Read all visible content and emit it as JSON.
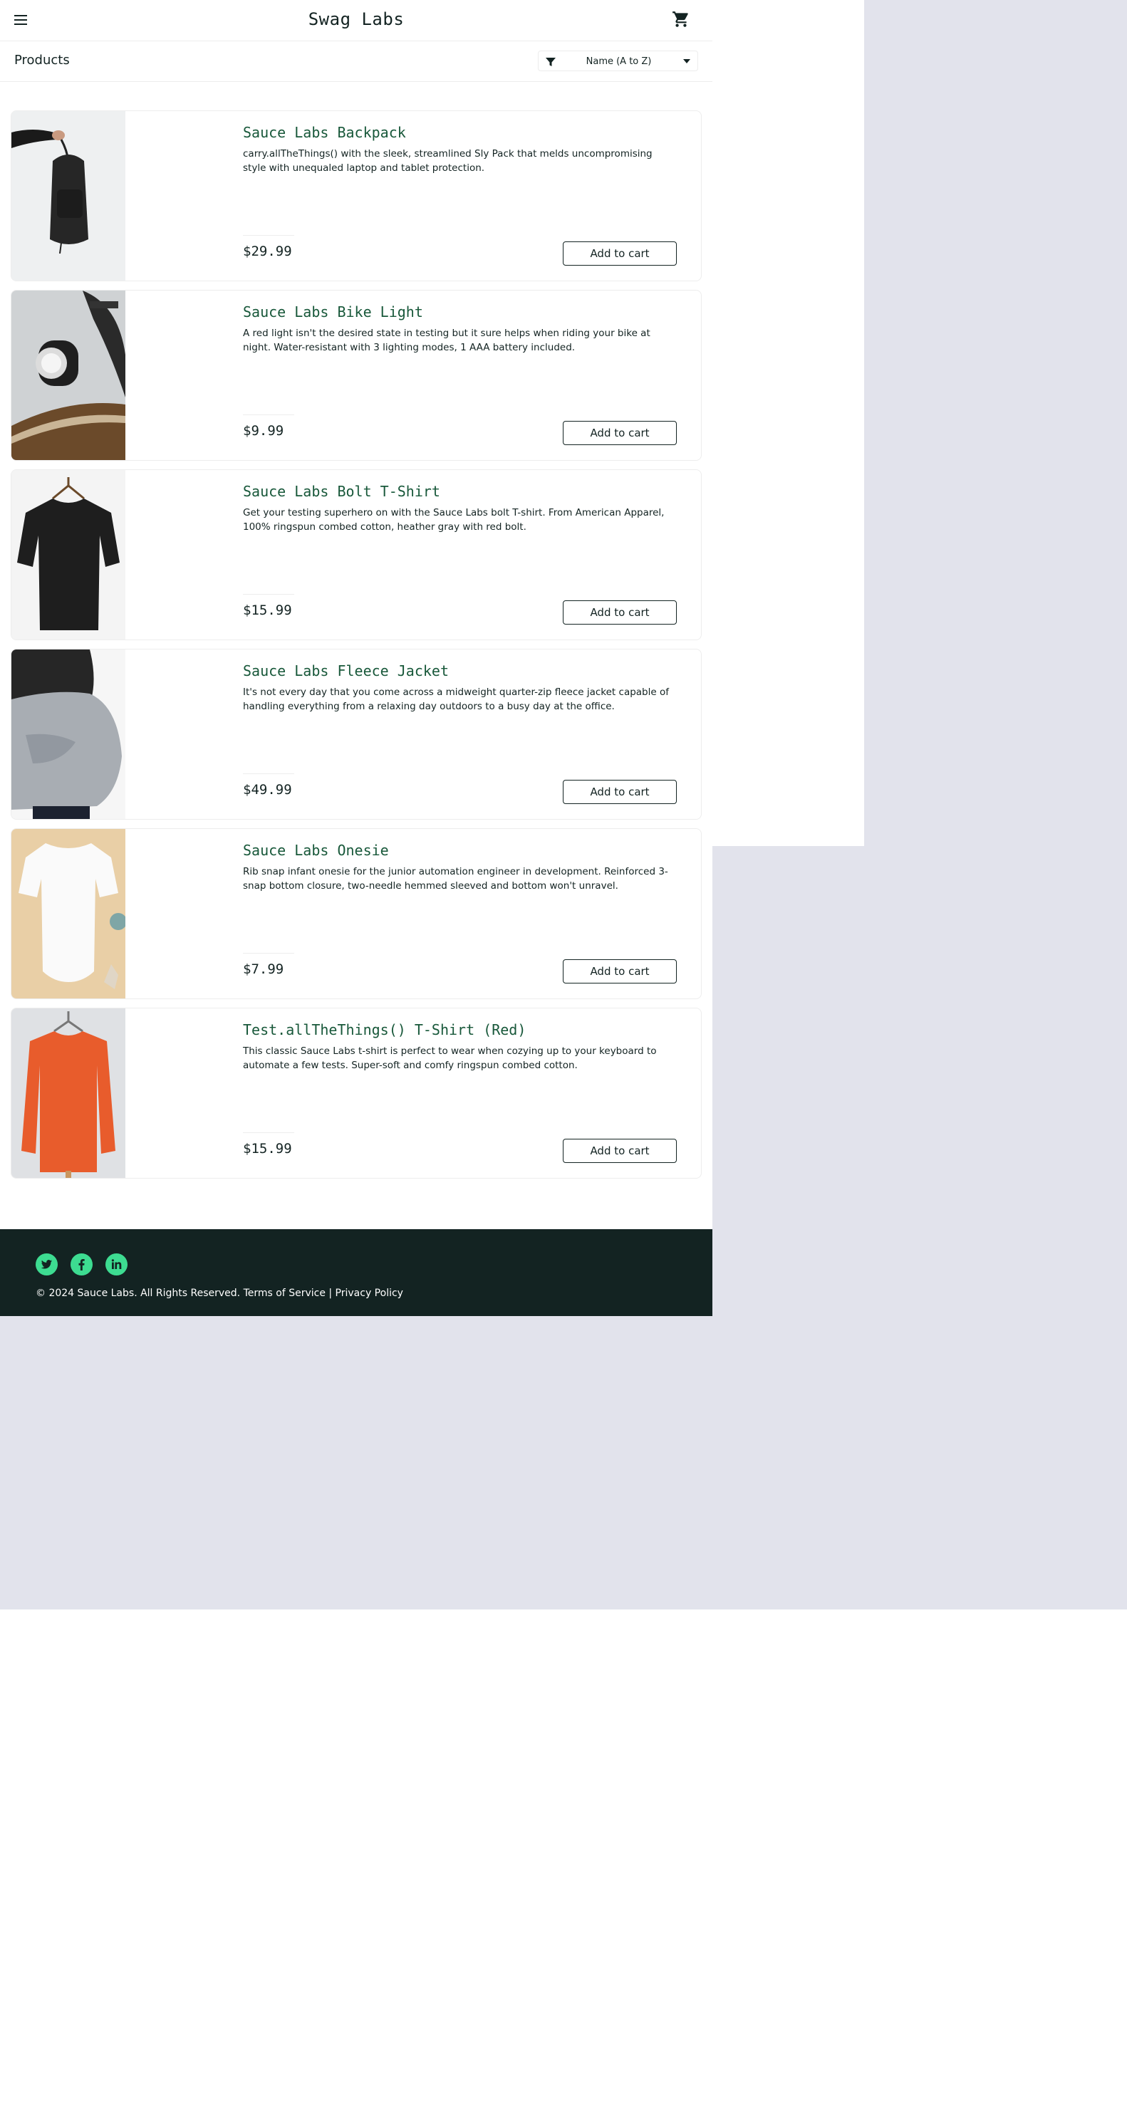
{
  "header": {
    "logo": "Swag Labs",
    "menu_icon": "hamburger-menu-icon",
    "cart_icon": "shopping-cart-icon"
  },
  "sub_header": {
    "title": "Products",
    "sort_icon": "filter-icon",
    "sort_selected": "Name (A to Z)"
  },
  "products": [
    {
      "name": "Sauce Labs Backpack",
      "description": "carry.allTheThings() with the sleek, streamlined Sly Pack that melds uncompromising style with unequaled laptop and tablet protection.",
      "price": "$29.99",
      "button": "Add to cart"
    },
    {
      "name": "Sauce Labs Bike Light",
      "description": "A red light isn't the desired state in testing but it sure helps when riding your bike at night. Water-resistant with 3 lighting modes, 1 AAA battery included.",
      "price": "$9.99",
      "button": "Add to cart"
    },
    {
      "name": "Sauce Labs Bolt T-Shirt",
      "description": "Get your testing superhero on with the Sauce Labs bolt T-shirt. From American Apparel, 100% ringspun combed cotton, heather gray with red bolt.",
      "price": "$15.99",
      "button": "Add to cart"
    },
    {
      "name": "Sauce Labs Fleece Jacket",
      "description": "It's not every day that you come across a midweight quarter-zip fleece jacket capable of handling everything from a relaxing day outdoors to a busy day at the office.",
      "price": "$49.99",
      "button": "Add to cart"
    },
    {
      "name": "Sauce Labs Onesie",
      "description": "Rib snap infant onesie for the junior automation engineer in development. Reinforced 3-snap bottom closure, two-needle hemmed sleeved and bottom won't unravel.",
      "price": "$7.99",
      "button": "Add to cart"
    },
    {
      "name": "Test.allTheThings() T-Shirt (Red)",
      "description": "This classic Sauce Labs t-shirt is perfect to wear when cozying up to your keyboard to automate a few tests. Super-soft and comfy ringspun combed cotton.",
      "price": "$15.99",
      "button": "Add to cart"
    }
  ],
  "footer": {
    "social": [
      "twitter-icon",
      "facebook-icon",
      "linkedin-icon"
    ],
    "copy": "© 2024 Sauce Labs. All Rights Reserved. Terms of Service | Privacy Policy"
  },
  "colors": {
    "brand_dark": "#132322",
    "product_name": "#18583a",
    "social_accent": "#3ddc91",
    "page_background": "#e2e3ec"
  }
}
